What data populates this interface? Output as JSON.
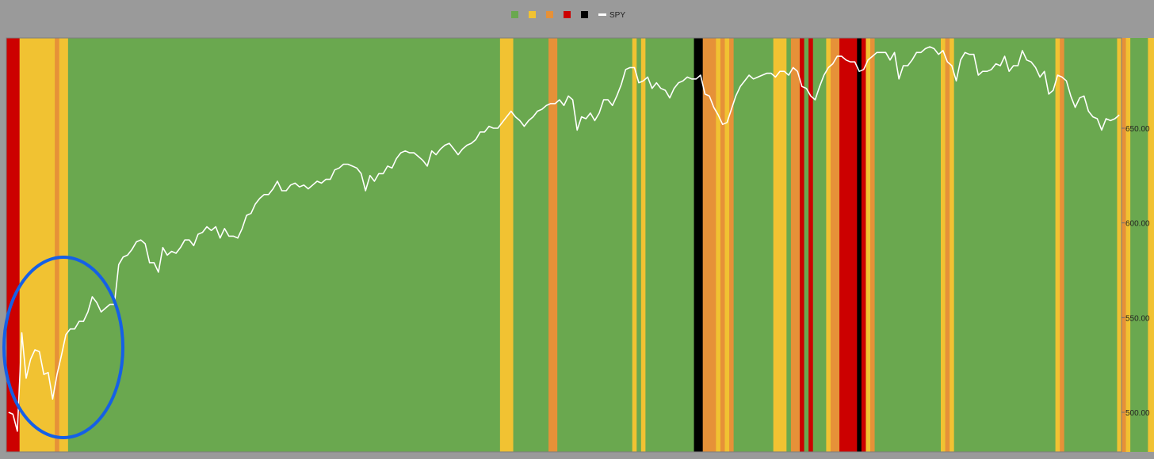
{
  "legend": {
    "items": [
      {
        "color": "#6aa84f",
        "label": ""
      },
      {
        "color": "#f1c232",
        "label": ""
      },
      {
        "color": "#e69138",
        "label": ""
      },
      {
        "color": "#cc0000",
        "label": ""
      },
      {
        "color": "#000000",
        "label": ""
      },
      {
        "color": "#ffffff",
        "label": "SPY"
      }
    ]
  },
  "chart_data": {
    "type": "line",
    "background": "#9a9a9a",
    "legend_position": "top-center",
    "grid": false,
    "ylim": [
      485,
      700
    ],
    "y_ticks": [
      "500.00",
      "550.00",
      "600.00",
      "650.00"
    ],
    "regime_colors": {
      "green": "#6aa84f",
      "yellow": "#f1c232",
      "orange": "#e69138",
      "red": "#cc0000",
      "black": "#000000"
    },
    "regime_bands": [
      {
        "regime": "red",
        "start": 0,
        "end": 3
      },
      {
        "regime": "yellow",
        "start": 3,
        "end": 11
      },
      {
        "regime": "orange",
        "start": 11,
        "end": 12
      },
      {
        "regime": "yellow",
        "start": 12,
        "end": 14
      },
      {
        "regime": "green",
        "start": 14,
        "end": 112
      },
      {
        "regime": "yellow",
        "start": 112,
        "end": 115
      },
      {
        "regime": "green",
        "start": 115,
        "end": 123
      },
      {
        "regime": "orange",
        "start": 123,
        "end": 125
      },
      {
        "regime": "green",
        "start": 125,
        "end": 142
      },
      {
        "regime": "yellow",
        "start": 142,
        "end": 143
      },
      {
        "regime": "green",
        "start": 143,
        "end": 144
      },
      {
        "regime": "yellow",
        "start": 144,
        "end": 145
      },
      {
        "regime": "green",
        "start": 145,
        "end": 156
      },
      {
        "regime": "black",
        "start": 156,
        "end": 158
      },
      {
        "regime": "orange",
        "start": 158,
        "end": 161
      },
      {
        "regime": "yellow",
        "start": 161,
        "end": 162
      },
      {
        "regime": "orange",
        "start": 162,
        "end": 163
      },
      {
        "regime": "yellow",
        "start": 163,
        "end": 164
      },
      {
        "regime": "orange",
        "start": 164,
        "end": 165
      },
      {
        "regime": "green",
        "start": 165,
        "end": 174
      },
      {
        "regime": "yellow",
        "start": 174,
        "end": 177
      },
      {
        "regime": "green",
        "start": 177,
        "end": 178
      },
      {
        "regime": "orange",
        "start": 178,
        "end": 180
      },
      {
        "regime": "red",
        "start": 180,
        "end": 181
      },
      {
        "regime": "green",
        "start": 181,
        "end": 182
      },
      {
        "regime": "red",
        "start": 182,
        "end": 183
      },
      {
        "regime": "green",
        "start": 183,
        "end": 186
      },
      {
        "regime": "yellow",
        "start": 186,
        "end": 187
      },
      {
        "regime": "orange",
        "start": 187,
        "end": 189
      },
      {
        "regime": "red",
        "start": 189,
        "end": 193
      },
      {
        "regime": "black",
        "start": 193,
        "end": 194
      },
      {
        "regime": "red",
        "start": 194,
        "end": 195
      },
      {
        "regime": "yellow",
        "start": 195,
        "end": 196
      },
      {
        "regime": "orange",
        "start": 196,
        "end": 197
      },
      {
        "regime": "green",
        "start": 197,
        "end": 212
      },
      {
        "regime": "yellow",
        "start": 212,
        "end": 213
      },
      {
        "regime": "orange",
        "start": 213,
        "end": 214
      },
      {
        "regime": "yellow",
        "start": 214,
        "end": 215
      },
      {
        "regime": "green",
        "start": 215,
        "end": 238
      },
      {
        "regime": "yellow",
        "start": 238,
        "end": 239
      },
      {
        "regime": "orange",
        "start": 239,
        "end": 240
      },
      {
        "regime": "green",
        "start": 240,
        "end": 252
      },
      {
        "regime": "yellow",
        "start": 252,
        "end": 253
      },
      {
        "regime": "orange",
        "start": 253,
        "end": 254
      },
      {
        "regime": "yellow",
        "start": 254,
        "end": 255
      },
      {
        "regime": "green",
        "start": 255,
        "end": 259
      },
      {
        "regime": "yellow",
        "start": 259,
        "end": 265
      },
      {
        "regime": "orange",
        "start": 265,
        "end": 266
      },
      {
        "regime": "yellow",
        "start": 266,
        "end": 267
      },
      {
        "regime": "green",
        "start": 267,
        "end": 270
      },
      {
        "regime": "yellow",
        "start": 270,
        "end": 272
      },
      {
        "regime": "orange",
        "start": 272,
        "end": 273
      },
      {
        "regime": "green",
        "start": 273,
        "end": 274
      },
      {
        "regime": "orange",
        "start": 274,
        "end": 277
      },
      {
        "regime": "red",
        "start": 277,
        "end": 278
      },
      {
        "regime": "yellow",
        "start": 278,
        "end": 279
      },
      {
        "regime": "orange",
        "start": 279,
        "end": 280
      },
      {
        "regime": "red",
        "start": 280,
        "end": 281
      },
      {
        "regime": "orange",
        "start": 281,
        "end": 282
      },
      {
        "regime": "black",
        "start": 282,
        "end": 285
      },
      {
        "regime": "red",
        "start": 285,
        "end": 286
      },
      {
        "regime": "orange",
        "start": 286,
        "end": 287
      },
      {
        "regime": "black",
        "start": 287,
        "end": 288
      },
      {
        "regime": "red",
        "start": 288,
        "end": 290
      },
      {
        "regime": "orange",
        "start": 290,
        "end": 291
      }
    ],
    "series": [
      {
        "name": "SPY",
        "color": "#ffffff",
        "values": [
          500,
          499,
          490,
          542,
          518,
          528,
          533,
          532,
          520,
          521,
          507,
          520,
          530,
          541,
          544,
          544,
          548,
          548,
          553,
          561,
          558,
          553,
          555,
          557,
          557,
          578,
          582,
          583,
          586,
          590,
          591,
          589,
          579,
          579,
          574,
          587,
          583,
          585,
          584,
          587,
          591,
          591,
          588,
          594,
          595,
          598,
          596,
          598,
          592,
          597,
          593,
          593,
          592,
          597,
          604,
          605,
          610,
          613,
          615,
          615,
          618,
          622,
          617,
          617,
          620,
          621,
          619,
          620,
          618,
          620,
          622,
          621,
          623,
          623,
          628,
          629,
          631,
          631,
          630,
          629,
          626,
          617,
          625,
          622,
          626,
          626,
          630,
          629,
          634,
          637,
          638,
          637,
          637,
          635,
          633,
          630,
          638,
          636,
          639,
          641,
          642,
          639,
          636,
          639,
          641,
          642,
          644,
          648,
          648,
          651,
          650,
          650,
          653,
          656,
          659,
          656,
          654,
          651,
          654,
          656,
          659,
          660,
          662,
          663,
          663,
          665,
          662,
          667,
          665,
          649,
          656,
          655,
          658,
          654,
          658,
          665,
          665,
          662,
          667,
          673,
          681,
          682,
          682,
          674,
          675,
          677,
          671,
          674,
          671,
          670,
          666,
          671,
          674,
          675,
          677,
          676,
          676,
          678,
          668,
          667,
          661,
          657,
          652,
          653,
          660,
          667,
          672,
          675,
          678,
          676,
          677,
          678,
          679,
          679,
          677,
          680,
          680,
          678,
          682,
          680,
          672,
          671,
          667,
          665,
          672,
          678,
          682,
          684,
          688,
          688,
          686,
          685,
          685,
          680,
          681,
          686,
          688,
          690,
          690,
          690,
          686,
          690,
          676,
          683,
          683,
          686,
          690,
          690,
          692,
          693,
          692,
          689,
          691,
          685,
          683,
          675,
          686,
          690,
          689,
          689,
          678,
          680,
          680,
          681,
          684,
          683,
          688,
          680,
          683,
          683,
          691,
          686,
          685,
          682,
          677,
          680,
          668,
          670,
          678,
          677,
          675,
          667,
          661,
          666,
          667,
          659,
          656,
          655,
          649,
          655,
          654,
          655,
          657
        ]
      }
    ]
  }
}
